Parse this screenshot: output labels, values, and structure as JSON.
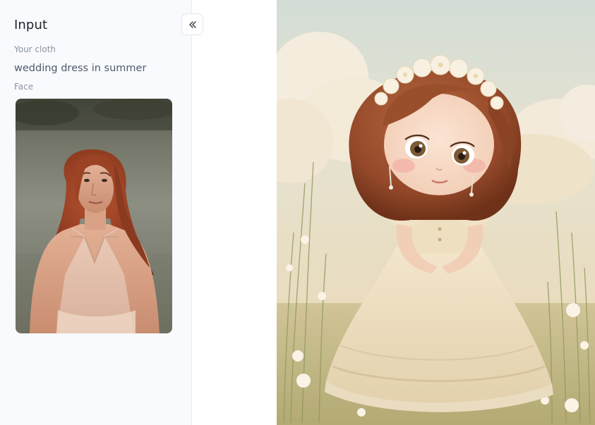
{
  "input_panel": {
    "title": "Input",
    "cloth_label": "Your cloth",
    "cloth_value": "wedding dress in summer",
    "face_label": "Face",
    "face_image": "photo-of-red-haired-woman"
  },
  "controls": {
    "collapse_icon": "double-chevron-left-icon"
  },
  "output": {
    "result_image": "illustrated-girl-in-wedding-dress-in-meadow"
  },
  "colors": {
    "panel_background": "#f8fafd",
    "title": "#1f2329",
    "label": "#8c95a3",
    "value": "#505a6b",
    "divider": "#e8ebf0"
  }
}
